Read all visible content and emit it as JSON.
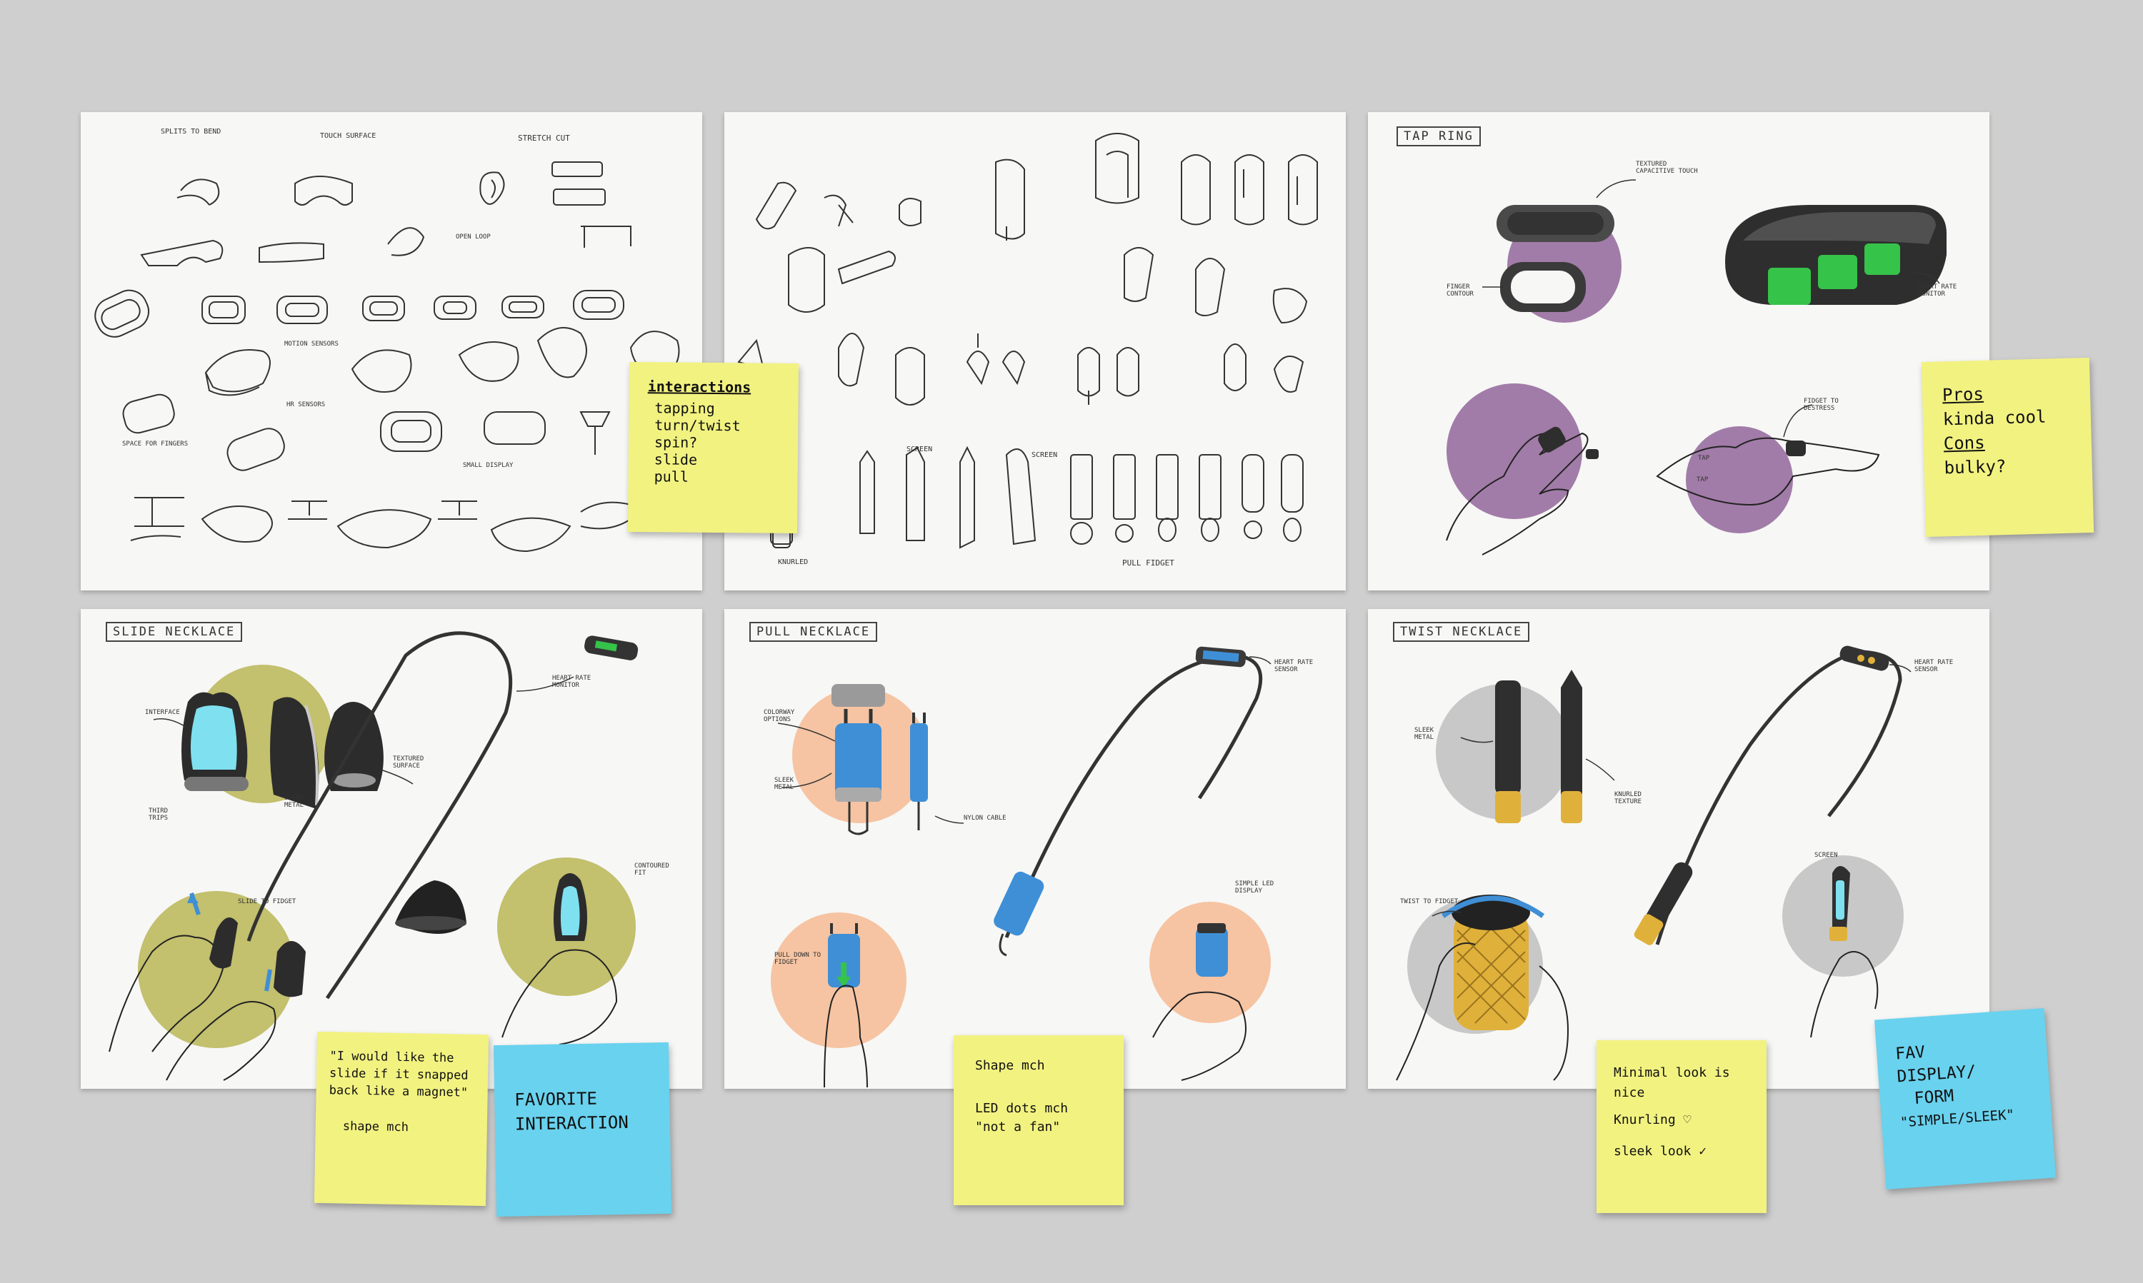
{
  "boards": {
    "b1": {
      "labels": [
        "SPLITS TO BEND",
        "TOUCH SURFACE",
        "STRETCH CUT",
        "OPEN LOOP",
        "MOTION SENSORS",
        "HR SENSORS",
        "SPACE FOR FINGERS",
        "SMALL DISPLAY"
      ]
    },
    "b2": {
      "labels": [
        "SCREEN",
        "SCREEN",
        "KNURLED",
        "PULL FIDGET"
      ]
    },
    "b3": {
      "title": "TAP RING",
      "labels": [
        "TEXTURED CAPACITIVE TOUCH",
        "FINGER CONTOUR",
        "HEART RATE MONITOR",
        "FIDGET TO DESTRESS",
        "TAP",
        "TAP"
      ]
    },
    "b4": {
      "title": "SLIDE NECKLACE",
      "labels": [
        "INTERFACE",
        "TEXTURED SURFACE",
        "SLEEK METAL",
        "THIRD TRIPS",
        "HEART RATE MONITOR",
        "SLIDE TO FIDGET",
        "CONTOURED FIT"
      ]
    },
    "b5": {
      "title": "PULL NECKLACE",
      "labels": [
        "COLORWAY OPTIONS",
        "SLEEK METAL",
        "NYLON CABLE",
        "HEART RATE SENSOR",
        "PULL DOWN TO FIDGET",
        "SIMPLE LED DISPLAY"
      ]
    },
    "b6": {
      "title": "TWIST NECKLACE",
      "labels": [
        "SLEEK METAL",
        "KNURLED TEXTURE",
        "HEART RATE SENSOR",
        "TWIST TO FIDGET",
        "SCREEN"
      ]
    }
  },
  "stickies": {
    "interactions": {
      "heading": "interactions",
      "lines": [
        "tapping",
        "turn/twist",
        "spin?",
        "slide",
        "pull"
      ]
    },
    "pros_cons": {
      "pros": "Pros",
      "pros_text": "kinda cool",
      "cons": "Cons",
      "cons_text": "bulky?"
    },
    "slide_quote": {
      "lines": [
        "\"I would like the",
        "slide if it snapped",
        "back like a magnet\"",
        "shape mch"
      ]
    },
    "favorite": {
      "lines": [
        "FAVORITE",
        "INTERACTION"
      ]
    },
    "pull_note": {
      "lines": [
        "Shape mch",
        "LED dots mch",
        "\"not a fan\""
      ]
    },
    "twist_note": {
      "lines": [
        "Minimal look is",
        "nice",
        "Knurling ♡",
        "sleek look ✓"
      ]
    },
    "fav_display": {
      "lines": [
        "FAV",
        "DISPLAY/",
        "FORM",
        "\"SIMPLE/SLEEK\""
      ]
    }
  },
  "colors": {
    "background": "#cfcfcf",
    "board": "#f7f7f6",
    "sticky_yellow": "#f2f281",
    "sticky_blue": "#69d2ee",
    "purple": "#a27ca8",
    "olive": "#c3c06e",
    "peach": "#f6c4a2",
    "grey": "#c8c8c8",
    "device_blue": "#3f8fd6",
    "gold": "#e0b13a",
    "led_green": "#35c34a"
  }
}
